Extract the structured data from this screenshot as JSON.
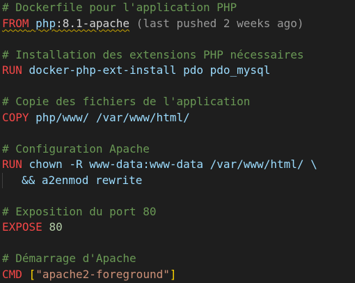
{
  "editor": {
    "lines": [
      [
        {
          "t": "# Dockerfile pour l'application PHP",
          "c": "comment"
        }
      ],
      [
        {
          "t": "FROM",
          "c": "kw",
          "squiggle": true
        },
        {
          "t": " ",
          "c": "plain",
          "squiggle": true
        },
        {
          "t": "php",
          "c": "ident",
          "squiggle": true
        },
        {
          "t": ":8.1-apache",
          "c": "plain",
          "squiggle": true
        },
        {
          "t": " (last pushed 2 weeks ago)",
          "c": "hint"
        }
      ],
      [],
      [
        {
          "t": "# Installation des extensions PHP nécessaires",
          "c": "comment"
        }
      ],
      [
        {
          "t": "RUN",
          "c": "kw"
        },
        {
          "t": " docker-php-ext-install pdo pdo_mysql",
          "c": "ident"
        }
      ],
      [],
      [
        {
          "t": "# Copie des fichiers de l'application",
          "c": "comment"
        }
      ],
      [
        {
          "t": "COPY",
          "c": "kw"
        },
        {
          "t": " php/www/ /var/www/html/",
          "c": "ident"
        }
      ],
      [],
      [
        {
          "t": "# Configuration Apache",
          "c": "comment"
        }
      ],
      [
        {
          "t": "RUN",
          "c": "kw"
        },
        {
          "t": " chown -R www-data:www-data /var/www/html/ \\",
          "c": "ident"
        }
      ],
      [
        {
          "t": "    ",
          "c": "indent"
        },
        {
          "t": "&& a2enmod rewrite",
          "c": "ident"
        }
      ],
      [],
      [
        {
          "t": "# Exposition du port 80",
          "c": "comment"
        }
      ],
      [
        {
          "t": "EXPOSE",
          "c": "kw"
        },
        {
          "t": " ",
          "c": "plain"
        },
        {
          "t": "80",
          "c": "num"
        }
      ],
      [],
      [
        {
          "t": "# Démarrage d'Apache",
          "c": "comment"
        }
      ],
      [
        {
          "t": "CMD",
          "c": "kw"
        },
        {
          "t": " ",
          "c": "plain"
        },
        {
          "t": "[",
          "c": "bracket"
        },
        {
          "t": "\"apache2-foreground\"",
          "c": "str"
        },
        {
          "t": "]",
          "c": "bracket"
        }
      ]
    ]
  },
  "colors": {
    "background": "#1e1e1e",
    "comment": "#6a9955",
    "keyword": "#f44747",
    "identifier": "#9cdcfe",
    "number": "#b5cea8",
    "string": "#ce9178",
    "bracket": "#ffd700",
    "hint": "#999999",
    "squiggle": "#cca700"
  }
}
